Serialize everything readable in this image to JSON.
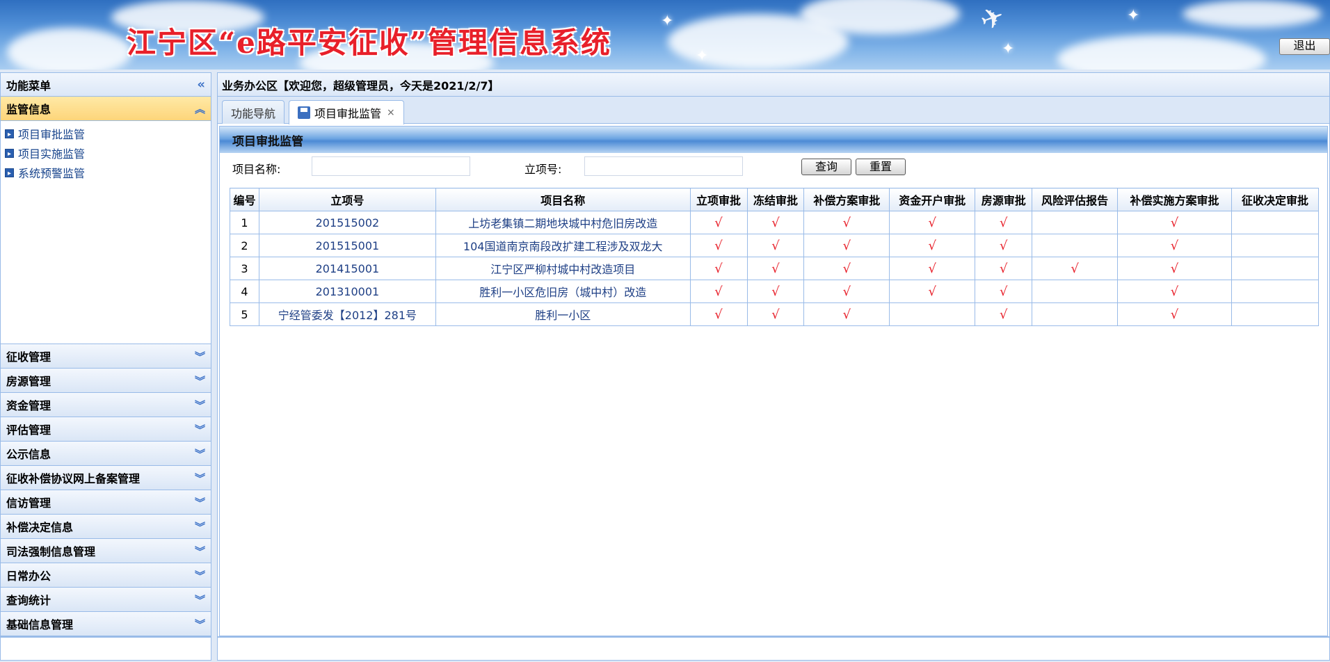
{
  "header": {
    "title": "江宁区“e路平安征收”管理信息系统",
    "logout_label": "退出"
  },
  "sidebar": {
    "title": "功能菜单",
    "active_section": "监管信息",
    "sub_items": [
      "项目审批监管",
      "项目实施监管",
      "系统预警监管"
    ],
    "sections": [
      "征收管理",
      "房源管理",
      "资金管理",
      "评估管理",
      "公示信息",
      "征收补偿协议网上备案管理",
      "信访管理",
      "补偿决定信息",
      "司法强制信息管理",
      "日常办公",
      "查询统计",
      "基础信息管理"
    ]
  },
  "main": {
    "header": "业务办公区【欢迎您，超级管理员，今天是2021/2/7】",
    "tabs": [
      "功能导航",
      "项目审批监管"
    ],
    "tab_close": "×",
    "panel_title": "项目审批监管",
    "search": {
      "name_label": "项目名称:",
      "name_value": "",
      "code_label": "立项号:",
      "code_value": "",
      "query_label": "查询",
      "reset_label": "重置"
    },
    "table": {
      "columns": [
        "编号",
        "立项号",
        "项目名称",
        "立项审批",
        "冻结审批",
        "补偿方案审批",
        "资金开户审批",
        "房源审批",
        "风险评估报告",
        "补偿实施方案审批",
        "征收决定审批"
      ],
      "rows": [
        [
          "1",
          "201515002",
          "上坊老集镇二期地块城中村危旧房改造",
          "√",
          "√",
          "√",
          "√",
          "√",
          "",
          "√",
          ""
        ],
        [
          "2",
          "201515001",
          "104国道南京南段改扩建工程涉及双龙大",
          "√",
          "√",
          "√",
          "√",
          "√",
          "",
          "√",
          ""
        ],
        [
          "3",
          "201415001",
          "江宁区严柳村城中村改造项目",
          "√",
          "√",
          "√",
          "√",
          "√",
          "√",
          "√",
          ""
        ],
        [
          "4",
          "201310001",
          "胜利一小区危旧房（城中村）改造",
          "√",
          "√",
          "√",
          "√",
          "√",
          "",
          "√",
          ""
        ],
        [
          "5",
          "宁经管委发【2012】281号",
          "胜利一小区",
          "√",
          "√",
          "√",
          "",
          "√",
          "",
          "√",
          ""
        ]
      ]
    }
  },
  "colors": {
    "accent": "#99bbe8",
    "check": "#e8202a",
    "active_section": "#fdd57a"
  }
}
